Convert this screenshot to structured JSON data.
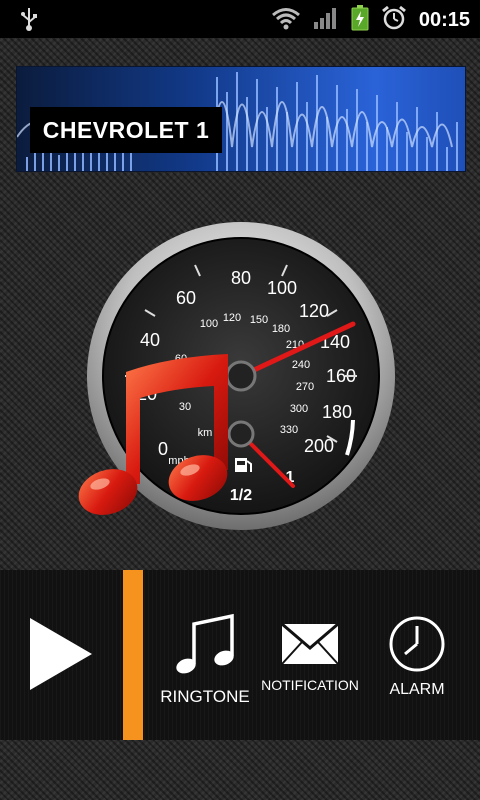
{
  "status_bar": {
    "time": "00:15",
    "icons": [
      "usb-icon",
      "wifi-icon",
      "signal-icon",
      "battery-charging-icon",
      "alarm-clock-icon"
    ]
  },
  "banner": {
    "track_title": "CHEVROLET 1"
  },
  "speedometer": {
    "outer_labels": [
      "0",
      "20",
      "40",
      "60",
      "80",
      "100",
      "120",
      "140",
      "160",
      "180",
      "200"
    ],
    "inner_labels": [
      "0",
      "30",
      "60",
      "90",
      "100",
      "120",
      "150",
      "180",
      "210",
      "240",
      "270",
      "300",
      "330"
    ],
    "unit_outer": "mph",
    "unit_inner": "km",
    "fuel_labels": [
      "1/2",
      "1"
    ],
    "icons": [
      "fuel-pump-icon",
      "music-note-icon"
    ]
  },
  "controls": {
    "ringtone_label": "RINGTONE",
    "notification_label": "NOTIFICATION",
    "alarm_label": "ALARM",
    "accent_color": "#f6921e",
    "icons": [
      "play-icon",
      "music-notes-icon",
      "envelope-icon",
      "clock-icon"
    ]
  }
}
